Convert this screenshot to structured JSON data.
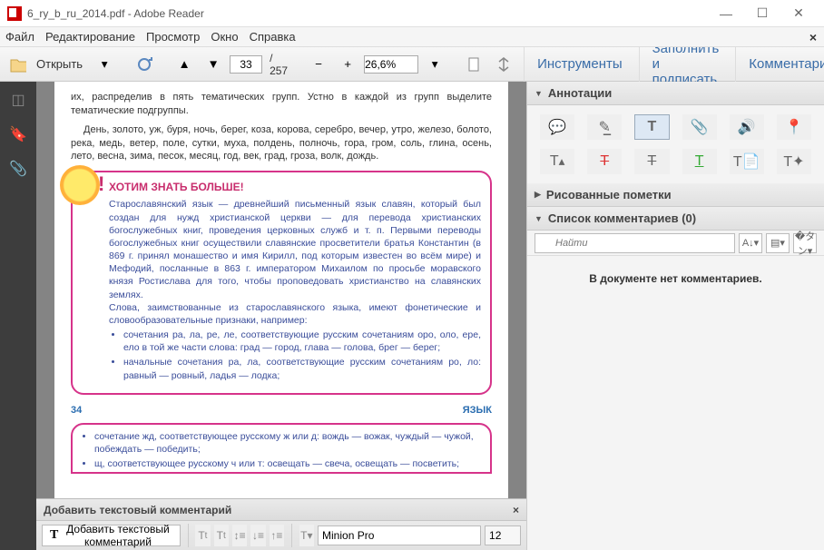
{
  "window": {
    "title": "6_ry_b_ru_2014.pdf - Adobe Reader"
  },
  "menu": {
    "file": "Файл",
    "edit": "Редактирование",
    "view": "Просмотр",
    "window": "Окно",
    "help": "Справка"
  },
  "toolbar": {
    "open": "Открыть",
    "page_current": "33",
    "page_total": "/  257",
    "zoom": "26,6%"
  },
  "tabs": {
    "tools": "Инструменты",
    "sign": "Заполнить и подписать",
    "comments": "Комментарии"
  },
  "rightpane": {
    "annotations": "Аннотации",
    "drawings_hdr": "Рисованные пометки",
    "comments_hdr": "Список комментариев (0)",
    "search_placeholder": "Найти",
    "nocomments": "В документе нет комментариев."
  },
  "commentbar": {
    "title": "Добавить текстовый комментарий",
    "add_btn": "Добавить текстовый комментарий",
    "font": "Minion Pro",
    "size": "12"
  },
  "doc": {
    "top_line": "их, распределив в пять тематических групп. Устно в каждой из групп выделите тематические подгруппы.",
    "para1": "День, золото, уж, буря, ночь, берег, коза, корова, серебро, вечер, утро, железо, болото, река, медь, ветер, поле, сутки, муха, полдень, полночь, гора, гром, соль, глина, осень, лето, весна, зима, песок, месяц, год, век, град, гроза, волк, дождь.",
    "heading": "ХОТИМ ЗНАТЬ БОЛЬШЕ!",
    "c1p1": "Старославянский язык — древнейший письменный язык славян, который был создан для нужд христианской церкви — для перевода христианских богослужебных книг, проведения церковных служб и т. п. Первыми переводы богослужебных книг осуществили славянские просветители братья Константин (в 869 г. принял монашество и имя Кирилл, под которым известен во всём мире) и Мефодий, посланные в 863 г. императором Михаилом по просьбе моравского князя Ростислава для того, чтобы проповедовать христианство на славянских землях.",
    "c1p2": "Слова, заимствованные из старославянского языка, имеют фонетические и словообразовательные признаки, например:",
    "c1li1": "сочетания ра, ла, ре, ле, соответствующие русским сочетаниям оро, оло, ере, ело в той же части слова: град — город, глава — голова, брег — берег;",
    "c1li2": "начальные сочетания ра, ла, соответствующие русским сочетаниям ро, ло: равный — ровный, ладья — лодка;",
    "pagenum": "34",
    "pagelabel": "ЯЗЫК",
    "c2li1": "сочетание жд, соответствующее русскому ж или д: вождь — вожак, чуждый — чужой, побеждать — победить;",
    "c2li2": "щ, соответствующее русскому ч или т: освещать — свеча, освещать — посветить;"
  }
}
